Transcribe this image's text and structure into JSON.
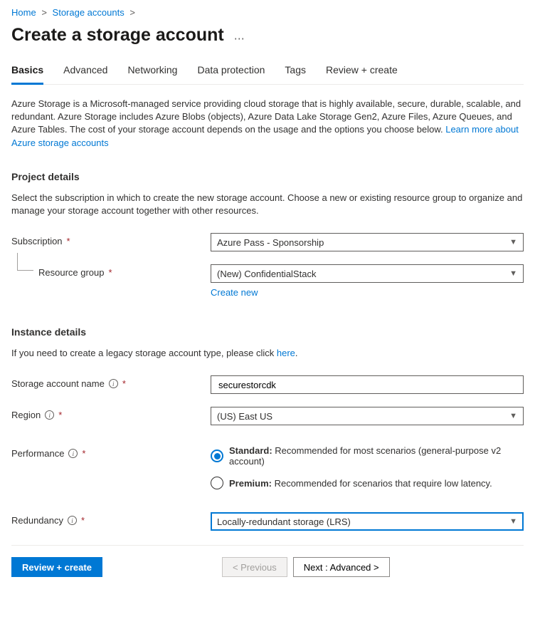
{
  "breadcrumb": {
    "home": "Home",
    "storage_accounts": "Storage accounts"
  },
  "title": "Create a storage account",
  "tabs": {
    "basics": "Basics",
    "advanced": "Advanced",
    "networking": "Networking",
    "data_protection": "Data protection",
    "tags": "Tags",
    "review": "Review + create"
  },
  "intro": {
    "text": "Azure Storage is a Microsoft-managed service providing cloud storage that is highly available, secure, durable, scalable, and redundant. Azure Storage includes Azure Blobs (objects), Azure Data Lake Storage Gen2, Azure Files, Azure Queues, and Azure Tables. The cost of your storage account depends on the usage and the options you choose below. ",
    "link": "Learn more about Azure storage accounts"
  },
  "project": {
    "heading": "Project details",
    "desc": "Select the subscription in which to create the new storage account. Choose a new or existing resource group to organize and manage your storage account together with other resources.",
    "subscription_label": "Subscription",
    "subscription_value": "Azure Pass - Sponsorship",
    "rg_label": "Resource group",
    "rg_value": "(New) ConfidentialStack",
    "create_new": "Create new"
  },
  "instance": {
    "heading": "Instance details",
    "desc_pre": "If you need to create a legacy storage account type, please click ",
    "desc_link": "here",
    "desc_post": ".",
    "name_label": "Storage account name",
    "name_value": "securestorcdk",
    "region_label": "Region",
    "region_value": "(US) East US",
    "perf_label": "Performance",
    "perf_standard_bold": "Standard:",
    "perf_standard_text": " Recommended for most scenarios (general-purpose v2 account)",
    "perf_premium_bold": "Premium:",
    "perf_premium_text": " Recommended for scenarios that require low latency.",
    "redundancy_label": "Redundancy",
    "redundancy_value": "Locally-redundant storage (LRS)"
  },
  "footer": {
    "review": "Review + create",
    "previous": "< Previous",
    "next": "Next : Advanced >"
  }
}
